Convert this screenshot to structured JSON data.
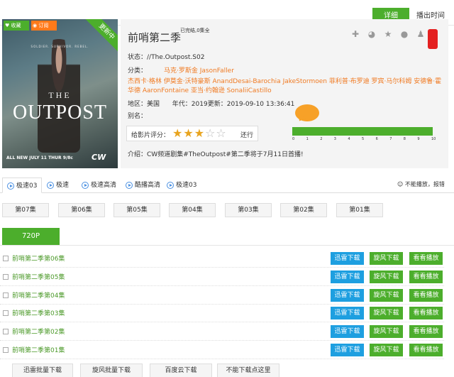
{
  "top_tabs": {
    "detail": "详细",
    "air_time": "播出时间"
  },
  "poster": {
    "favorite": "收藏",
    "subscribe": "订阅",
    "ribbon": "更新中",
    "tagline": "SOLDIER. SURVIVOR. REBEL.",
    "title_the": "THE",
    "title_main": "OUTPOST",
    "air_date": "ALL NEW JULY 11 THUR 9/8c",
    "network": "CW"
  },
  "info": {
    "title": "前哨第二季",
    "status_note": "已完结,0集全",
    "state_label": "状态：",
    "state_value": "//The.Outpost.S02",
    "category_label": "分类：",
    "category_value": "马克·罗斯金 JasonFaller",
    "cast": "杰西卡·格林 伊莫金·沃特豪斯 AnandDesai-Barochia JakeStormoen 菲利普·布罗迪 罗宾·马尔科姆 安德鲁·霍华德 AaronFontaine 亚当·约翰逊 SonaliiCastillo",
    "region_label": "地区：",
    "region_value": "美国",
    "year_label": "年代：",
    "year_value": "2019",
    "update_label": "更新：",
    "update_value": "2019-09-10 13:36:41",
    "alias_label": "别名：",
    "alias_value": "",
    "rating_label": "给影片评分：",
    "rating_stars": 3,
    "rating_max": 5,
    "rating_verdict": "还行",
    "scale_ticks": [
      "0",
      "1",
      "2",
      "3",
      "4",
      "5",
      "6",
      "7",
      "8",
      "9",
      "10"
    ],
    "intro_label": "介绍：",
    "intro_value": "CW频道剧集#TheOutpost#第二季将于7月11日首播!"
  },
  "share_icons": [
    "plus-icon",
    "weibo-icon",
    "star-icon",
    "wechat-icon",
    "qq-icon"
  ],
  "sources": [
    "极速03",
    "极速",
    "极速高清",
    "酷播高清",
    "极速03"
  ],
  "report": "不能播放，报错",
  "episodes": [
    "第07集",
    "第06集",
    "第05集",
    "第04集",
    "第03集",
    "第02集",
    "第01集"
  ],
  "quality": "720P",
  "downloads": {
    "button_labels": {
      "xunlei": "迅雷下载",
      "xuanfeng": "旋风下载",
      "kankan": "看看播放"
    },
    "items": [
      "前哨第二季第06集",
      "前哨第二季第05集",
      "前哨第二季第04集",
      "前哨第二季第03集",
      "前哨第二季第02集",
      "前哨第二季第01集"
    ]
  },
  "bottom_buttons": [
    "迅雷批量下载",
    "旋风批量下载",
    "百度云下载",
    "不能下载点这里"
  ],
  "colors": {
    "accent_green": "#4cae2c",
    "accent_blue": "#1e9fe0",
    "orange": "#f07a22",
    "star": "#e8a41f"
  }
}
